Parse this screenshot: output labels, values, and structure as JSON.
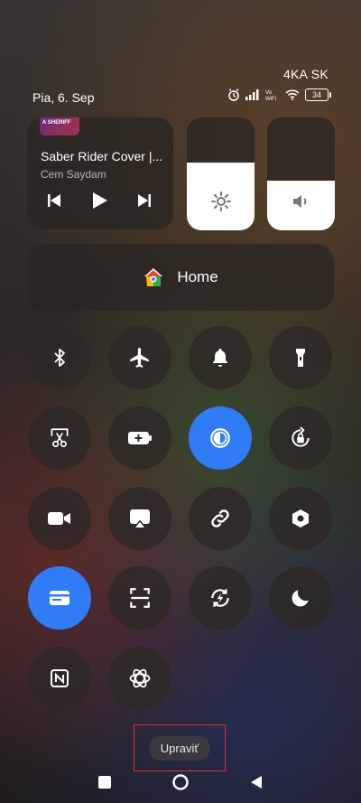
{
  "status_bar": {
    "carrier": "4KA SK",
    "date": "Pia, 6. Sep",
    "battery": "34",
    "icons": [
      "alarm-icon",
      "signal-icon",
      "volte-wifi-icon",
      "wifi-icon",
      "battery-icon"
    ]
  },
  "media": {
    "album_text": "A SHERIFF",
    "song_title": "Saber Rider Cover |...",
    "artist": "Cem Saydam"
  },
  "sliders": {
    "brightness_level": 0.6,
    "volume_level": 0.44
  },
  "home": {
    "label": "Home"
  },
  "tiles": [
    {
      "name": "bluetooth",
      "active": false
    },
    {
      "name": "airplane-mode",
      "active": false
    },
    {
      "name": "sound",
      "active": false
    },
    {
      "name": "flashlight",
      "active": false
    },
    {
      "name": "screenshot",
      "active": false
    },
    {
      "name": "battery-saver",
      "active": false
    },
    {
      "name": "dark-mode",
      "active": true
    },
    {
      "name": "rotation-lock",
      "active": false
    },
    {
      "name": "screen-recorder",
      "active": false
    },
    {
      "name": "cast",
      "active": false
    },
    {
      "name": "link",
      "active": false
    },
    {
      "name": "settings",
      "active": false
    },
    {
      "name": "wallet",
      "active": true
    },
    {
      "name": "scanner",
      "active": false
    },
    {
      "name": "data-saver",
      "active": false
    },
    {
      "name": "night-mode",
      "active": false
    },
    {
      "name": "nfc",
      "active": false
    },
    {
      "name": "chatgpt",
      "active": false
    }
  ],
  "edit": {
    "label": "Upraviť"
  },
  "colors": {
    "accent": "#2f7cf6",
    "tile": "#2d2826"
  }
}
